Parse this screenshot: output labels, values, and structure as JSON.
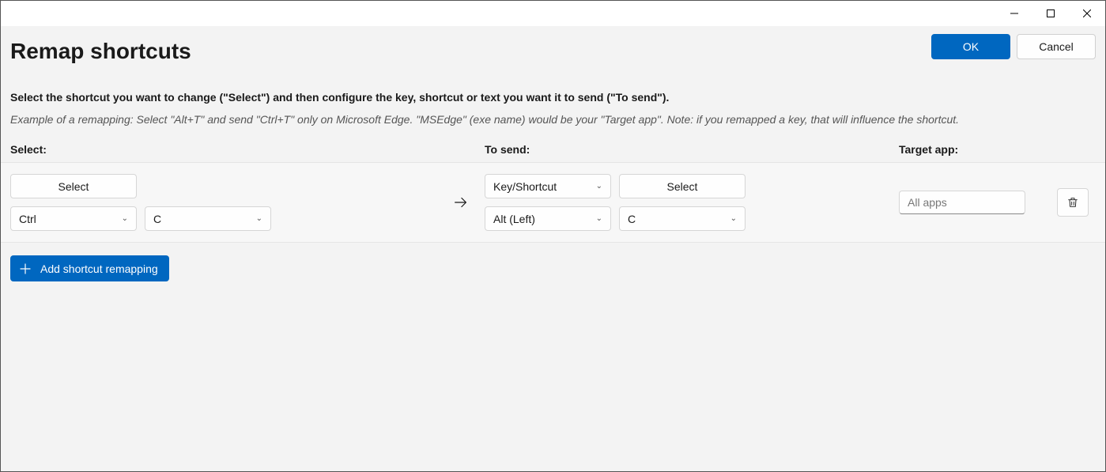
{
  "titlebar": {
    "minimize": "—",
    "maximize": "▢",
    "close": "✕"
  },
  "header": {
    "title": "Remap shortcuts",
    "ok_label": "OK",
    "cancel_label": "Cancel"
  },
  "instructions": {
    "main": "Select the shortcut you want to change (\"Select\") and then configure the key, shortcut or text you want it to send (\"To send\").",
    "example": "Example of a remapping: Select \"Alt+T\" and send \"Ctrl+T\" only on Microsoft Edge. \"MSEdge\" (exe name) would be your \"Target app\". Note: if you remapped a key, that will influence the shortcut."
  },
  "columns": {
    "select": "Select:",
    "tosend": "To send:",
    "target": "Target app:"
  },
  "row": {
    "select_btn": "Select",
    "select_key1": "Ctrl",
    "select_key2": "C",
    "send_type": "Key/Shortcut",
    "send_select_btn": "Select",
    "send_key1": "Alt (Left)",
    "send_key2": "C",
    "target_placeholder": "All apps"
  },
  "add_label": "Add shortcut remapping"
}
